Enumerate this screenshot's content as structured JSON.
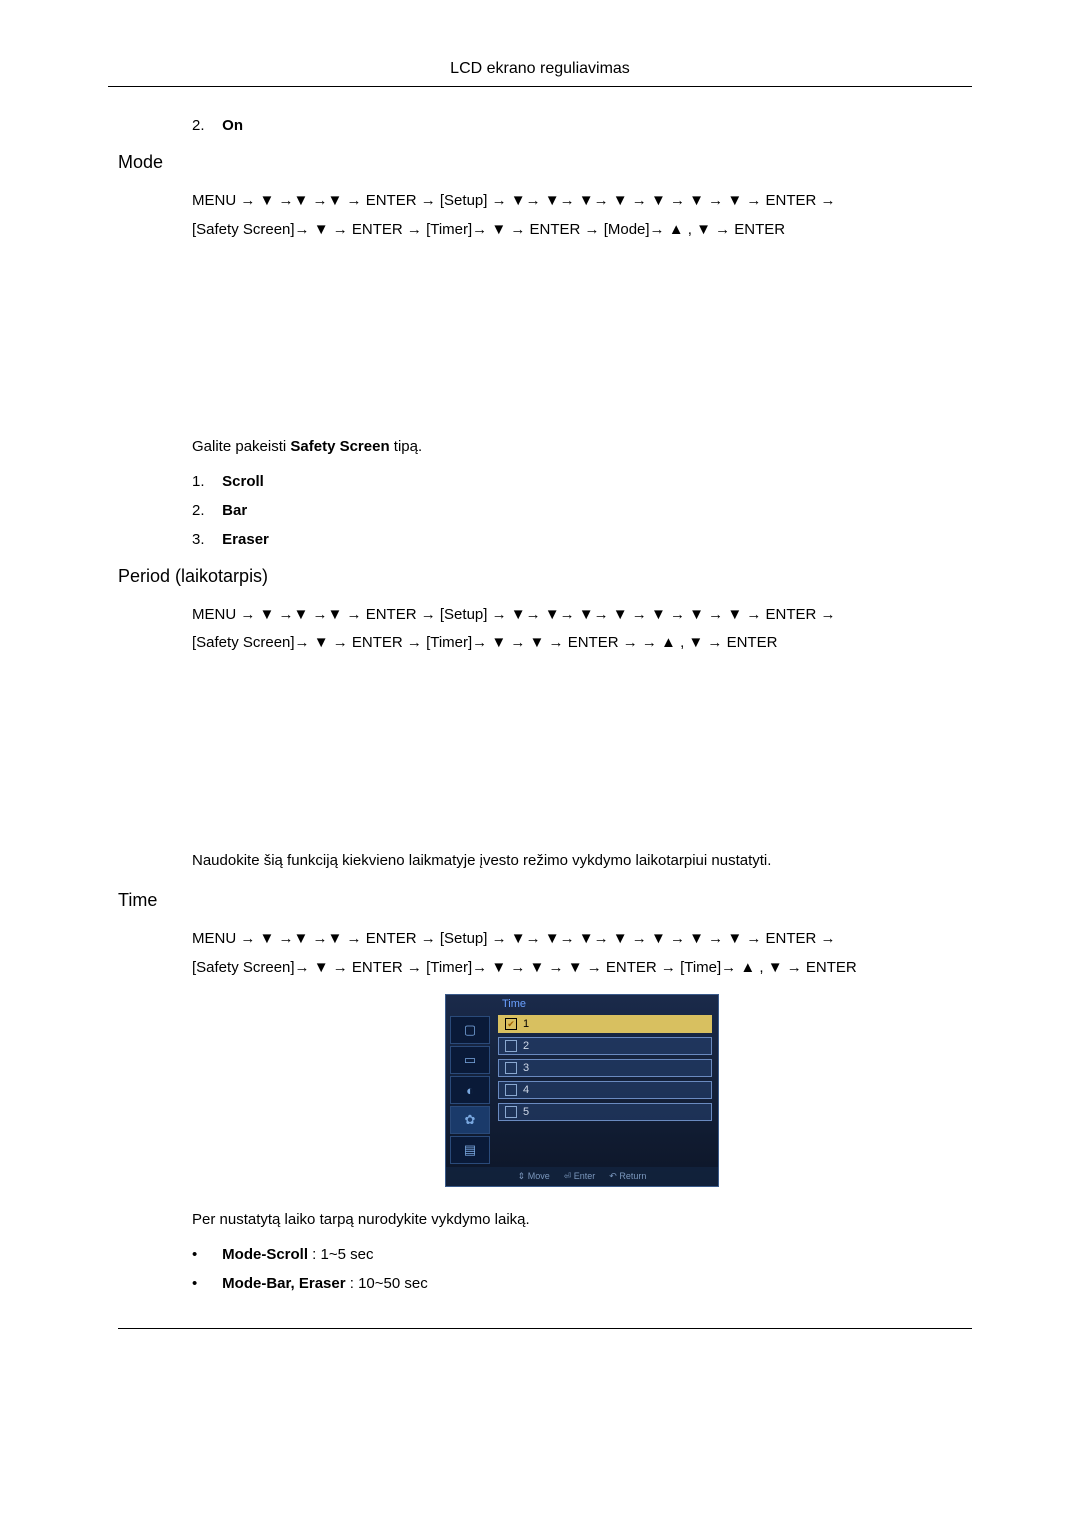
{
  "header": {
    "title": "LCD ekrano reguliavimas"
  },
  "initial_item": {
    "num": "2.",
    "label": "On"
  },
  "mode": {
    "heading": "Mode",
    "nav_line1": "MENU → ▼ →▼ →▼ → ENTER → [Setup] → ▼→ ▼→ ▼→ ▼ → ▼ → ▼ → ▼ → ENTER →",
    "nav_line2_a": "[Safety Screen]→ ▼ → ENTER → [Timer]→ ▼ → ENTER → [Mode]→ ▲ , ▼ → ENTER",
    "body_prefix": "Galite pakeisti ",
    "body_bold": "Safety Screen",
    "body_suffix": " tipą.",
    "items": [
      {
        "num": "1.",
        "label": "Scroll"
      },
      {
        "num": "2.",
        "label": "Bar"
      },
      {
        "num": "3.",
        "label": "Eraser"
      }
    ]
  },
  "period": {
    "heading": "Period (laikotarpis)",
    "nav_line1": "MENU → ▼ →▼ →▼ → ENTER → [Setup] → ▼→ ▼→ ▼→ ▼ → ▼ → ▼ → ▼ → ENTER →",
    "nav_line2": "[Safety Screen]→ ▼ → ENTER → [Timer]→ ▼ → ▼ → ENTER →          → ▲ , ▼ → ENTER",
    "body": "Naudokite šią funkciją kiekvieno laikmatyje įvesto režimo vykdymo laikotarpiui nustatyti."
  },
  "time": {
    "heading": "Time",
    "nav_line1": "MENU → ▼ →▼ →▼ → ENTER → [Setup] → ▼→ ▼→ ▼→ ▼ → ▼ → ▼ → ▼ → ENTER →",
    "nav_line2": "[Safety Screen]→ ▼ → ENTER → [Timer]→ ▼ → ▼ → ▼ → ENTER → [Time]→ ▲ , ▼ → ENTER",
    "osd": {
      "title": "Time",
      "options": [
        "1",
        "2",
        "3",
        "4",
        "5"
      ],
      "selected": "1",
      "hint_move": "Move",
      "hint_enter": "Enter",
      "hint_return": "Return"
    },
    "body": "Per nustatytą laiko tarpą nurodykite vykdymo laiką.",
    "bullets": [
      {
        "bold": "Mode-Scroll",
        "rest": " : 1~5 sec"
      },
      {
        "bold": "Mode-Bar, Eraser",
        "rest": " : 10~50 sec"
      }
    ]
  }
}
